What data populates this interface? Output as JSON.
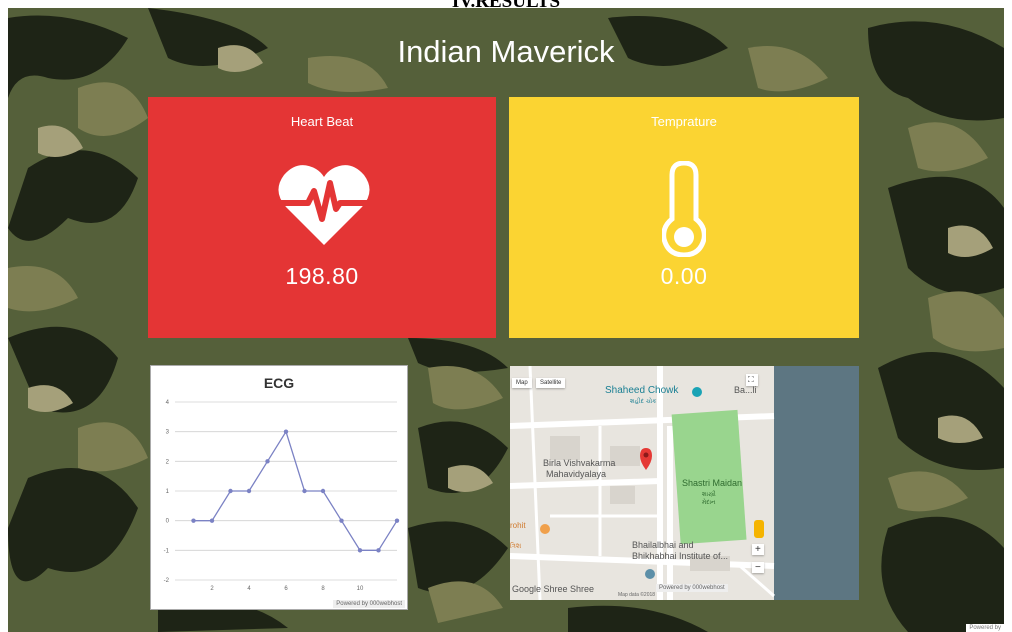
{
  "doc_heading": "IV.RESULTS",
  "app": {
    "title": "Indian Maverick"
  },
  "cards": {
    "heart": {
      "title": "Heart Beat",
      "value": "198.80",
      "color": "#e43535",
      "icon": "heart-pulse-icon"
    },
    "temp": {
      "title": "Temprature",
      "value": "0.00",
      "color": "#fbd432",
      "icon": "thermometer-icon"
    }
  },
  "ecg": {
    "powered_by": "Powered by 000webhost"
  },
  "chart_data": {
    "type": "line",
    "title": "ECG",
    "x": [
      1,
      2,
      3,
      4,
      5,
      6,
      7,
      8,
      9,
      10,
      11,
      12
    ],
    "values": [
      0,
      0,
      1,
      1,
      2,
      3,
      1,
      1,
      0,
      -1,
      -1,
      0
    ],
    "xticks": [
      2,
      4,
      6,
      8,
      10
    ],
    "yticks": [
      -2,
      -1,
      0,
      1,
      2,
      3,
      4
    ],
    "ylim": [
      -2,
      4
    ],
    "xlim": [
      0,
      12
    ],
    "grid": true,
    "color": "#7b82c4"
  },
  "map": {
    "type_buttons": [
      "Map",
      "Satellite"
    ],
    "labels": {
      "shaheed_chowk": "Shaheed Chowk",
      "shaheed_sub": "શહીદ ચોક",
      "birla_1": "Birla Vishvakarma",
      "birla_2": "Mahavidyalaya",
      "shastri": "Shastri Maidan",
      "shastri_sub_1": "શાસ્ત્રી",
      "shastri_sub_2": "મેદાન",
      "bhailal_1": "Bhailalbhai and",
      "bhailal_2": "Bhikhabhai Institute of...",
      "shree": "Google  Shree Shree",
      "partial_top": "Ba...li",
      "partial_left_1": "rohit",
      "partial_left_2": "ત્રિશ"
    },
    "footer": "Map data ©2018",
    "powered_by": "Powered by 000webhost",
    "zoom_in": "+",
    "zoom_out": "−"
  },
  "corner_badge": "Powered by"
}
